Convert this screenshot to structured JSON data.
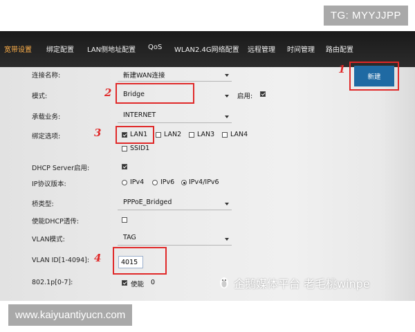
{
  "watermarks": {
    "top": "TG: MYYJJPP",
    "bottom": "www.kaiyuantiyucn.com",
    "overlay": "企鹅媒体平台 老毛桃winpe"
  },
  "nav": {
    "items": [
      {
        "label": "宽带设置",
        "active": true
      },
      {
        "label": "绑定配置"
      },
      {
        "label": "LAN侧地址配置"
      },
      {
        "label": "QoS"
      },
      {
        "label": "WLAN2.4G网络配置"
      },
      {
        "label": "远程管理"
      },
      {
        "label": "时间管理"
      },
      {
        "label": "路由配置"
      }
    ]
  },
  "new_button": "新建",
  "form": {
    "connection_name": {
      "label": "连接名称:",
      "value": "新建WAN连接"
    },
    "mode": {
      "label": "模式:",
      "value": "Bridge",
      "enable_label": "启用:",
      "enabled": true
    },
    "service": {
      "label": "承载业务:",
      "value": "INTERNET"
    },
    "binding": {
      "label": "绑定选项:",
      "options": [
        {
          "label": "LAN1",
          "checked": true
        },
        {
          "label": "LAN2",
          "checked": false
        },
        {
          "label": "LAN3",
          "checked": false
        },
        {
          "label": "LAN4",
          "checked": false
        },
        {
          "label": "SSID1",
          "checked": false
        }
      ]
    },
    "dhcp_server": {
      "label": "DHCP Server启用:",
      "checked": true
    },
    "ip_version": {
      "label": "IP协议版本:",
      "options": [
        {
          "label": "IPv4",
          "selected": false
        },
        {
          "label": "IPv6",
          "selected": false
        },
        {
          "label": "IPv4/IPv6",
          "selected": true
        }
      ]
    },
    "bridge_type": {
      "label": "桥类型:",
      "value": "PPPoE_Bridged"
    },
    "dhcp_relay": {
      "label": "使能DHCP透传:",
      "checked": false
    },
    "vlan_mode": {
      "label": "VLAN模式:",
      "value": "TAG"
    },
    "vlan_id": {
      "label": "VLAN ID[1-4094]:",
      "value": "4015"
    },
    "priority": {
      "label": "802.1p[0-7]:",
      "enable_label": "使能",
      "value": "0",
      "checked": true
    }
  },
  "annotations": [
    "1",
    "2",
    "3",
    "4"
  ],
  "colors": {
    "annotation": "#e02828",
    "button": "#1f6aa3",
    "nav_active": "#ffb04a"
  }
}
